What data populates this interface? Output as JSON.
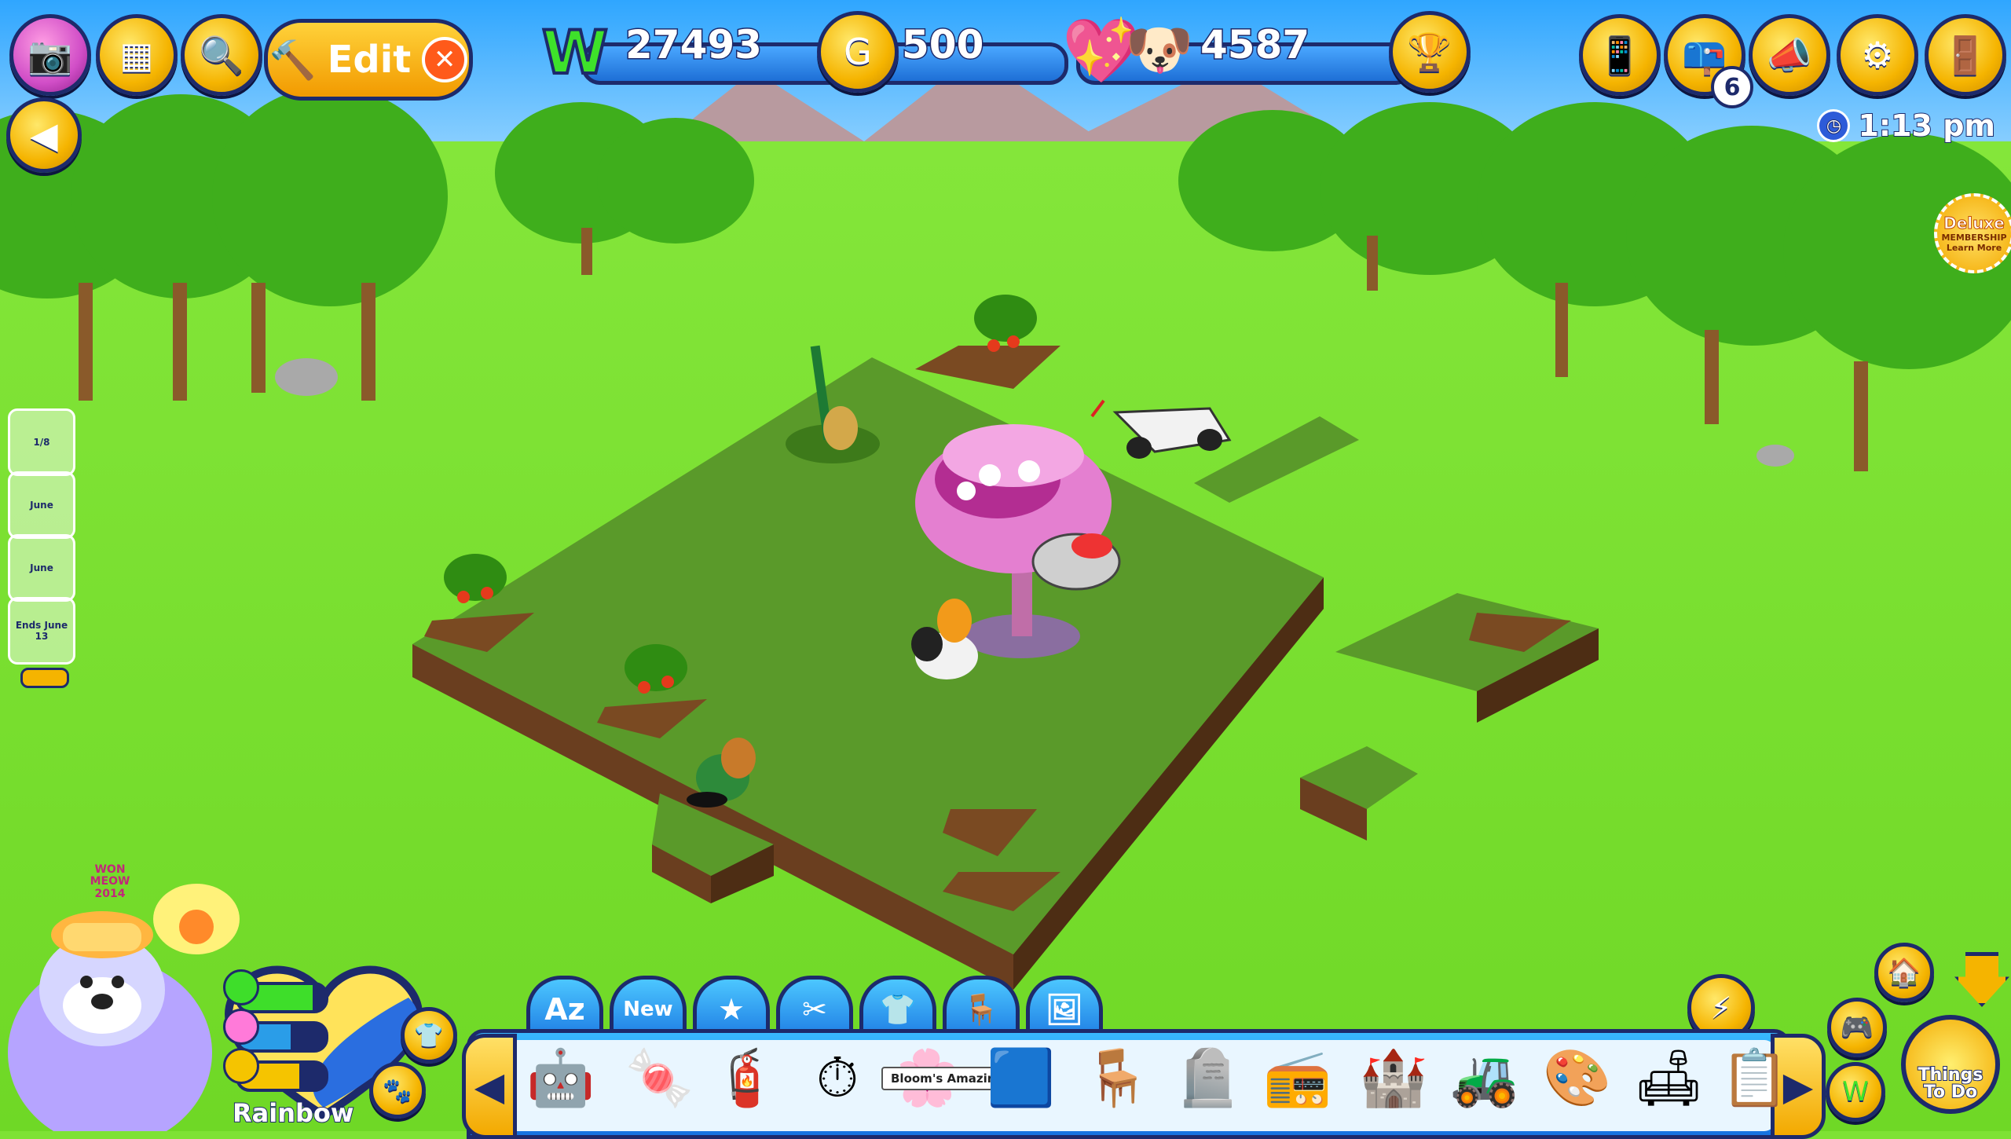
{
  "header": {
    "edit_label": "Edit",
    "kinzcash": "27493",
    "gems": "500",
    "happiness": "4587",
    "time": "1:13 pm",
    "mail_count": "6"
  },
  "events": [
    {
      "label": "1/8"
    },
    {
      "label": "June"
    },
    {
      "label": "June"
    },
    {
      "label": "Ends June 13"
    }
  ],
  "deluxe_badge": {
    "title": "Deluxe",
    "subtitle": "MEMBERSHIP",
    "cta": "Learn More"
  },
  "pet": {
    "name": "Rainbow",
    "hat_text": "WON MEOW 2014"
  },
  "toolbar": {
    "tabs": [
      "Az",
      "New",
      "★",
      "✂",
      "👕",
      "🪑",
      "🖼"
    ],
    "hover_tooltip": "Bloom's Amazing Tree"
  },
  "things_to_do": {
    "label": "Things To Do"
  },
  "colors": {
    "grass": "#7ee234",
    "sky": "#35b7ff",
    "ui_blue": "#1d73e0",
    "ui_gold": "#f5b400",
    "outline": "#1d2a6b"
  }
}
